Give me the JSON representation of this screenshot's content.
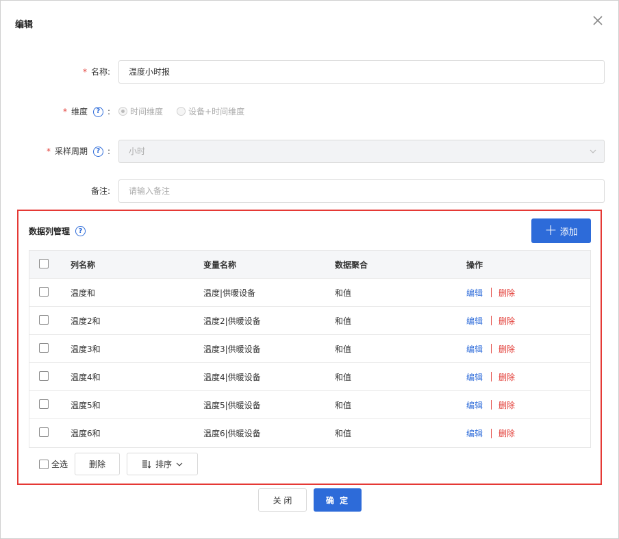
{
  "dialog": {
    "title": "编辑",
    "close_icon": "close-icon"
  },
  "form": {
    "name": {
      "required_mark": "*",
      "label": "名称:",
      "value": "温度小时报"
    },
    "dimension": {
      "required_mark": "*",
      "label": "维度",
      "colon": ":",
      "options": [
        "时间维度",
        "设备+时间维度"
      ],
      "selected": "时间维度"
    },
    "period": {
      "required_mark": "*",
      "label": "采样周期",
      "colon": ":",
      "value": "小时"
    },
    "remark": {
      "label": "备注:",
      "placeholder": "请输入备注"
    }
  },
  "columns_section": {
    "title": "数据列管理",
    "add_label": "添加",
    "headers": [
      "列名称",
      "变量名称",
      "数据聚合",
      "操作"
    ],
    "rows": [
      {
        "name": "温度和",
        "variable": "温度|供暖设备",
        "agg": "和值",
        "edit": "编辑",
        "delete": "删除"
      },
      {
        "name": "温度2和",
        "variable": "温度2|供暖设备",
        "agg": "和值",
        "edit": "编辑",
        "delete": "删除"
      },
      {
        "name": "温度3和",
        "variable": "温度3|供暖设备",
        "agg": "和值",
        "edit": "编辑",
        "delete": "删除"
      },
      {
        "name": "温度4和",
        "variable": "温度4|供暖设备",
        "agg": "和值",
        "edit": "编辑",
        "delete": "删除"
      },
      {
        "name": "温度5和",
        "variable": "温度5|供暖设备",
        "agg": "和值",
        "edit": "编辑",
        "delete": "删除"
      },
      {
        "name": "温度6和",
        "variable": "温度6|供暖设备",
        "agg": "和值",
        "edit": "编辑",
        "delete": "删除"
      }
    ],
    "footer": {
      "select_all": "全选",
      "delete": "删除",
      "sort": "排序"
    }
  },
  "actions": {
    "close": "关 闭",
    "ok": "确 定"
  },
  "colors": {
    "primary": "#2d6bd9",
    "danger": "#e3413b",
    "highlight_border": "#e53935"
  }
}
